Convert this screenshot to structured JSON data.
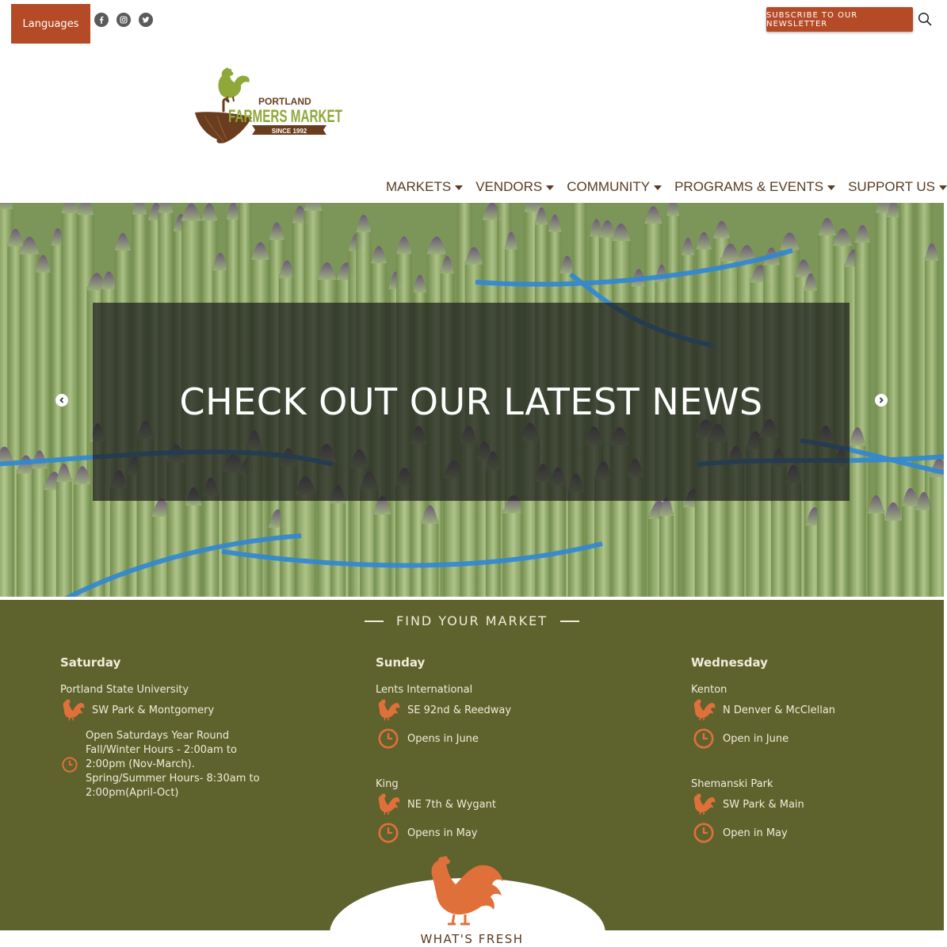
{
  "topbar": {
    "languages_label": "Languages",
    "social": [
      "facebook-icon",
      "instagram-icon",
      "twitter-icon"
    ],
    "subscribe_label": "SUBSCRIBE TO OUR NEWSLETTER"
  },
  "logo": {
    "line1": "PORTLAND",
    "line2": "FARMERS MARKET",
    "line3": "SINCE 1992"
  },
  "nav": {
    "items": [
      {
        "label": "MARKETS"
      },
      {
        "label": "VENDORS"
      },
      {
        "label": "COMMUNITY"
      },
      {
        "label": "PROGRAMS & EVENTS"
      },
      {
        "label": "SUPPORT US"
      }
    ]
  },
  "hero": {
    "title": "CHECK OUT OUR LATEST NEWS"
  },
  "market": {
    "heading": "FIND YOUR MARKET",
    "columns": [
      {
        "day": "Saturday",
        "markets": [
          {
            "name": "Portland State University",
            "address": "SW Park & Montgomery",
            "hours": [
              "Open Saturdays Year Round",
              "Fall/Winter Hours - 2:00am to",
              "2:00pm (Nov-March).",
              "Spring/Summer Hours- 8:30am to",
              "2:00pm(April-Oct)"
            ]
          }
        ]
      },
      {
        "day": "Sunday",
        "markets": [
          {
            "name": "Lents International",
            "address": "SE 92nd & Reedway",
            "hours": [
              "Opens in June"
            ]
          },
          {
            "name": "King",
            "address": "NE 7th & Wygant",
            "hours": [
              "Opens in May"
            ]
          }
        ]
      },
      {
        "day": "Wednesday",
        "markets": [
          {
            "name": "Kenton",
            "address": "N Denver & McClellan",
            "hours": [
              "Open in June"
            ]
          },
          {
            "name": "Shemanski Park",
            "address": "SW Park & Main",
            "hours": [
              "Open in May"
            ]
          }
        ]
      }
    ]
  },
  "fresh": {
    "title": "WHAT'S FRESH"
  },
  "colors": {
    "brand_orange": "#b54a26",
    "market_green": "#5e632e",
    "icon_orange": "#e0703a",
    "logo_green": "#8ea83a",
    "logo_brown": "#6a3d1e"
  }
}
